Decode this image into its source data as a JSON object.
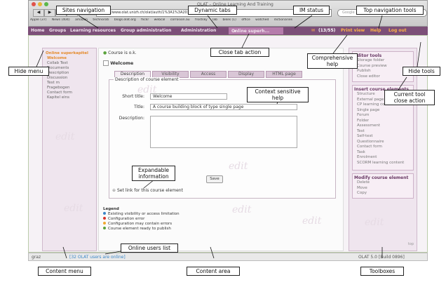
{
  "browser": {
    "window_title": "OLAT – Online Learning And Training",
    "url": "https://www.olat.unizh.ch/olat/auth/1%3A1%3A20343139063%3A0%3A0/",
    "search_placeholder": "Google",
    "bookmarks": [
      "Apple (37)",
      "News (404)",
      "amazon",
      "technorati",
      "blogs.olat.org",
      "flickr",
      "webcal",
      "corrosion.au",
      "frostsky",
      "lab",
      "bikes (1)",
      "office",
      "watched",
      "dictionaries"
    ]
  },
  "topnav": {
    "items": [
      "Home",
      "Groups",
      "Learning resources",
      "Group administration",
      "Administration"
    ],
    "dynamic_tab": "Online superh...",
    "dynamic_tab_close": "x",
    "im_status": "(13/55)",
    "print_view": "Print view",
    "help": "Help",
    "logout": "Log out"
  },
  "left_menu": {
    "title": "Online superkapitel",
    "items": [
      "Welcome",
      "Collab Test",
      "Documents",
      "Description",
      "Discussion",
      "Test m",
      "Fragebogen",
      "Contact form",
      "Kapitel eins"
    ]
  },
  "main": {
    "status": "Course is o.k.",
    "node_title": "Welcome",
    "tabs": [
      "Description",
      "Visibility",
      "Access",
      "Display",
      "HTML page"
    ],
    "fieldset_legend": "Description of course element",
    "short_title_label": "Short title:",
    "short_title_value": "Welcome",
    "char_count": "648",
    "title_label": "Title:",
    "title_value": "A course building block of type single page",
    "description_label": "Description:",
    "save_label": "Save",
    "set_link_label": "Set link for this course element",
    "legend_title": "Legend",
    "legend_items": [
      {
        "text": "Existing visibility or access limitation",
        "color": "#3a86c8"
      },
      {
        "text": "Configuration error",
        "color": "#d9342b"
      },
      {
        "text": "Configuration may contain errors",
        "color": "#f0a830"
      },
      {
        "text": "Course element ready to publish",
        "color": "#5aa33c"
      }
    ],
    "top_link": "top"
  },
  "right_tools": {
    "editor_tools_title": "Editor tools",
    "editor_tools": [
      "Storage folder",
      "Course preview",
      "Publish",
      "Close editor"
    ],
    "insert_title": "Insert course elements",
    "insert_items": [
      "Structure",
      "External page",
      "CP learning content",
      "Single page",
      "Forum",
      "Folder",
      "Assessment",
      "Test",
      "Self-test",
      "Questionnaire",
      "Contact form",
      "Task",
      "Enrolment",
      "SCORM learning content"
    ],
    "modify_title": "Modify course element",
    "modify_items": [
      "Delete",
      "Move",
      "Copy"
    ]
  },
  "bottom_bar": {
    "left": "graz",
    "online_users": "[32 OLAT users are online]",
    "version": "OLAT 5.0 [Build 0896]"
  },
  "watermark": "edit",
  "annotations": {
    "sites_navigation": "Sites navigation",
    "dynamic_tabs": "Dynamic tabs",
    "im_status": "IM status",
    "top_navigation_tools": "Top navigation tools",
    "hide_menu": "Hide menu",
    "close_tab_action": "Close tab action",
    "comprehensive_help": "Comprehensive help",
    "hide_tools": "Hide tools",
    "current_tool_close_action": "Current tool close action",
    "context_sensitive_help": "Context sensitive help",
    "expandable_information": "Expandable information",
    "online_users_list": "Online users list",
    "content_menu": "Content menu",
    "content_area": "Content area",
    "toolboxes": "Toolboxes"
  }
}
